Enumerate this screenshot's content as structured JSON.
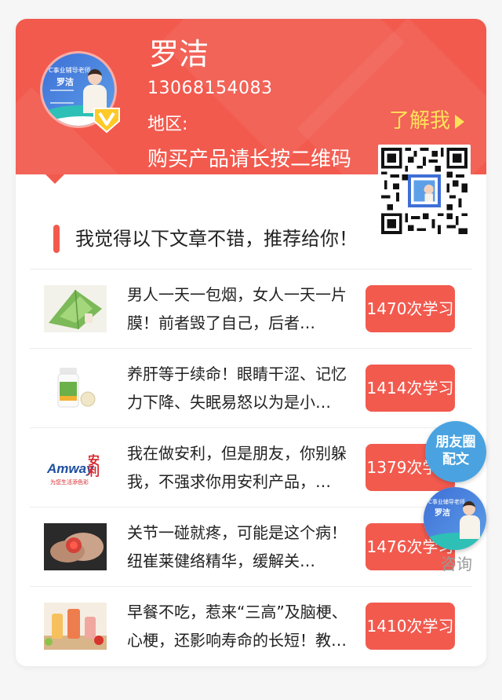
{
  "profile": {
    "name": "罗洁",
    "phone": "13068154083",
    "region_label": "地区:",
    "buy_tip": "购买产品请长按二维码",
    "about_label": "了解我",
    "avatar_caption_title": "C事业辅导老师",
    "avatar_caption_name": "罗洁"
  },
  "section": {
    "title": "我觉得以下文章不错，推荐给你！"
  },
  "articles": [
    {
      "title": "男人一天一包烟，女人一天一片膜！前者毁了自己，后者…",
      "count": "1470次学习",
      "thumb_icon": "leaf-photo-icon"
    },
    {
      "title": "养肝等于续命！眼睛干涩、记忆力下降、失眠易怒以为是小…",
      "count": "1414次学习",
      "thumb_icon": "supplement-bottle-icon"
    },
    {
      "title": "我在做安利，但是朋友，你别躲我，不强求你用安利产品，…",
      "count": "1379次学习",
      "thumb_icon": "amway-logo-icon"
    },
    {
      "title": "关节一碰就疼，可能是这个病！纽崔莱健络精华，缓解关…",
      "count": "1476次学习",
      "thumb_icon": "knee-photo-icon"
    },
    {
      "title": "早餐不吃，惹来“三高”及脑梗、心梗，还影响寿命的长短！教…",
      "count": "1410次学习",
      "thumb_icon": "breakfast-photo-icon"
    }
  ],
  "logo_text": {
    "brand": "Amway",
    "cn": "安利",
    "slogan": "为您生活添色彩"
  },
  "floating": {
    "moments_line1": "朋友圈",
    "moments_line2": "配文",
    "avatar_caption_title": "C事业辅导老师",
    "avatar_caption_name": "罗洁",
    "consult_label": "咨询"
  },
  "colors": {
    "accent": "#f25a4e",
    "about_text": "#ffe25a",
    "float_blue": "#4aa3e0"
  }
}
